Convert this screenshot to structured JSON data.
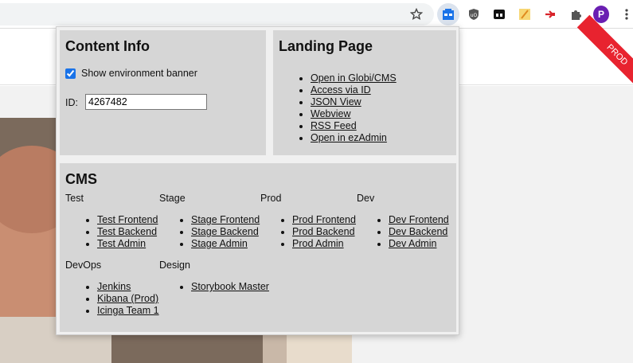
{
  "browser": {
    "icons": [
      "star-icon",
      "extension-cms-icon",
      "shield-icon",
      "tabs-icon",
      "notes-icon",
      "redirect-icon",
      "puzzle-icon"
    ],
    "profile_initial": "P"
  },
  "page": {
    "ribbon": "PROD"
  },
  "content_info": {
    "title": "Content Info",
    "banner_label": "Show environment banner",
    "banner_checked": true,
    "id_label": "ID:",
    "id_value": "4267482"
  },
  "landing_page": {
    "title": "Landing Page",
    "links": [
      "Open in Globi/CMS",
      "Access via ID",
      "JSON View",
      "Webview",
      "RSS Feed",
      "Open in ezAdmin"
    ]
  },
  "cms": {
    "title": "CMS",
    "groups": [
      {
        "name": "Test",
        "links": [
          "Test Frontend",
          "Test Backend",
          "Test Admin"
        ]
      },
      {
        "name": "Stage",
        "links": [
          "Stage Frontend",
          "Stage Backend",
          "Stage Admin"
        ]
      },
      {
        "name": "Prod",
        "links": [
          "Prod Frontend",
          "Prod Backend",
          "Prod Admin"
        ]
      },
      {
        "name": "Dev",
        "links": [
          "Dev Frontend",
          "Dev Backend",
          "Dev Admin"
        ]
      },
      {
        "name": "DevOps",
        "links": [
          "Jenkins",
          "Kibana (Prod)",
          "Icinga Team 1"
        ]
      },
      {
        "name": "Design",
        "links": [
          "Storybook Master"
        ]
      }
    ]
  },
  "colors": {
    "accent": "#1a73e8",
    "panel": "#d6d6d6",
    "ribbon": "#e8232f"
  }
}
